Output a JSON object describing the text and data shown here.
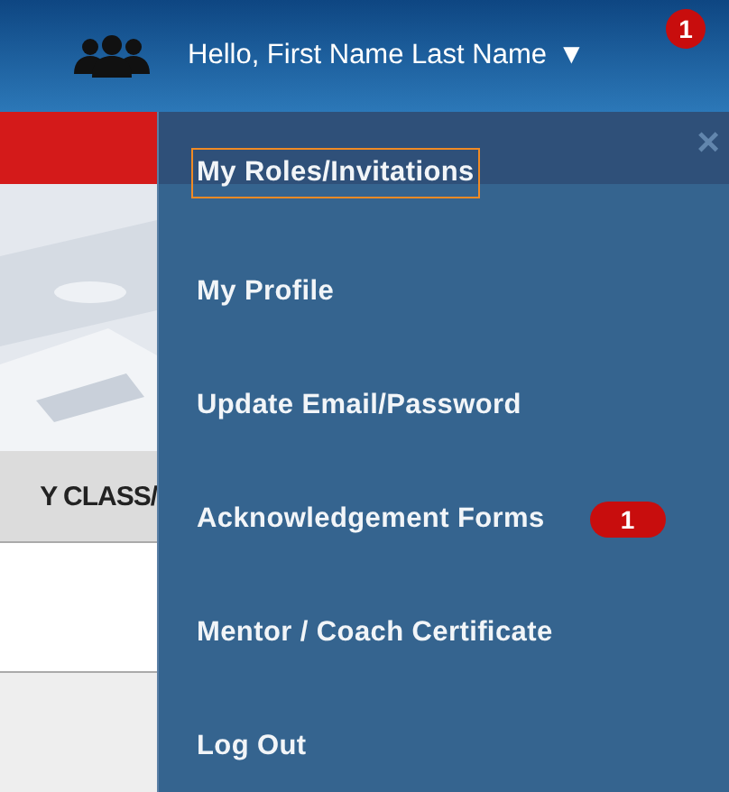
{
  "header": {
    "greeting": "Hello, First Name Last Name",
    "caret": "▼",
    "notification_count": "1"
  },
  "background": {
    "banner_text": "Y CLASS/"
  },
  "menu": {
    "close": "×",
    "items": [
      {
        "label": "My Roles/Invitations",
        "focused": true
      },
      {
        "label": "My Profile",
        "focused": false
      },
      {
        "label": "Update Email/Password",
        "focused": false
      },
      {
        "label": "Acknowledgement Forms",
        "focused": false,
        "badge": "1"
      },
      {
        "label": "Mentor / Coach Certificate",
        "focused": false
      },
      {
        "label": "Log Out",
        "focused": false
      }
    ]
  }
}
